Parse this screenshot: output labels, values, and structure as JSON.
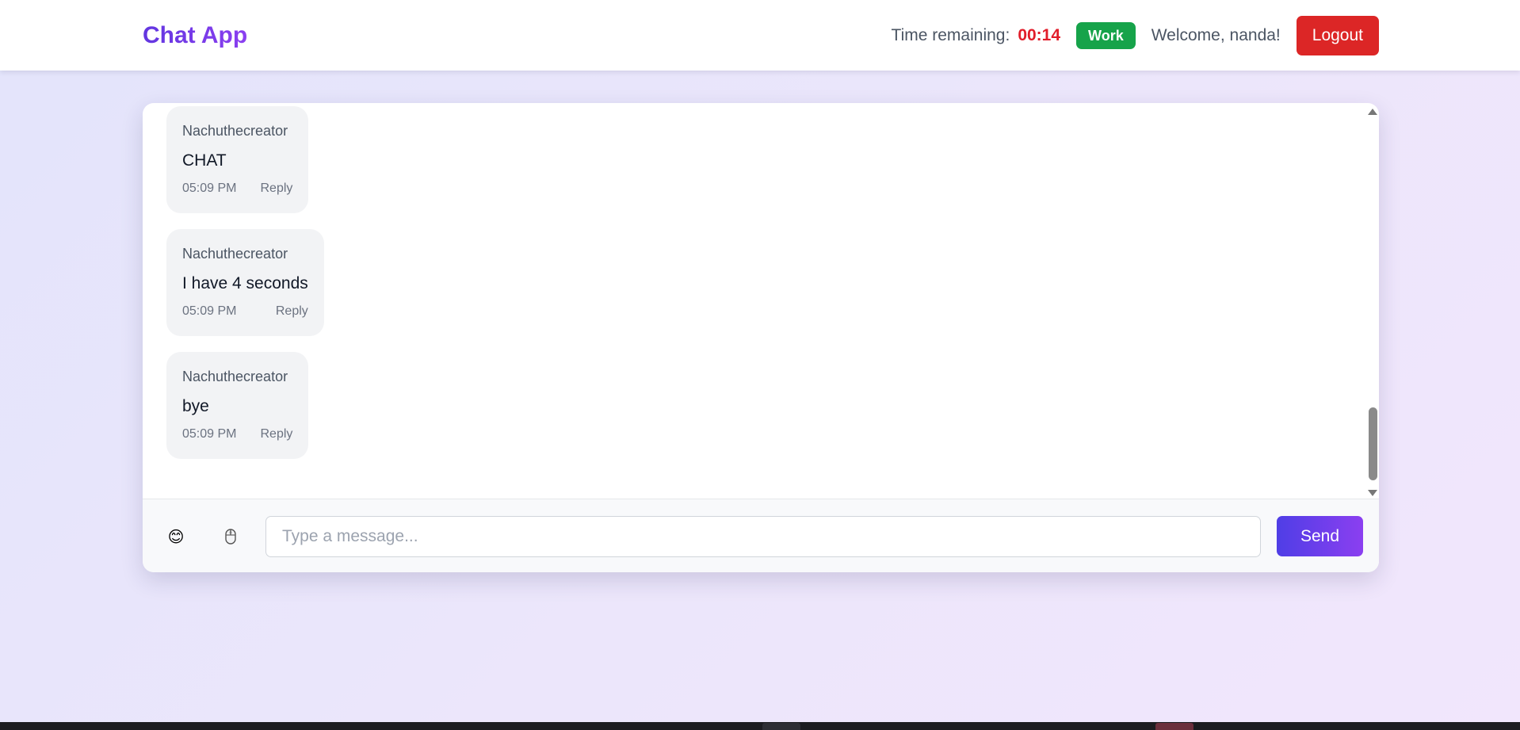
{
  "header": {
    "app_title": "Chat App",
    "timer_label": "Time remaining:",
    "timer_value": "00:14",
    "mode_badge": "Work",
    "welcome_text": "Welcome, nanda!",
    "logout_label": "Logout"
  },
  "messages": [
    {
      "author": "Nachuthecreator",
      "text": "CHAT",
      "time": "05:09 PM",
      "reply_label": "Reply"
    },
    {
      "author": "Nachuthecreator",
      "text": "I have 4 seconds",
      "time": "05:09 PM",
      "reply_label": "Reply"
    },
    {
      "author": "Nachuthecreator",
      "text": "bye",
      "time": "05:09 PM",
      "reply_label": "Reply"
    }
  ],
  "composer": {
    "emoji_icon": "😊",
    "attach_icon": "mouse-icon",
    "placeholder": "Type a message...",
    "send_label": "Send"
  },
  "colors": {
    "brand_gradient": [
      "#6236e0",
      "#8b3ff0"
    ],
    "timer": "#e11d2a",
    "badge": "#16a34a",
    "logout": "#dc2626"
  }
}
